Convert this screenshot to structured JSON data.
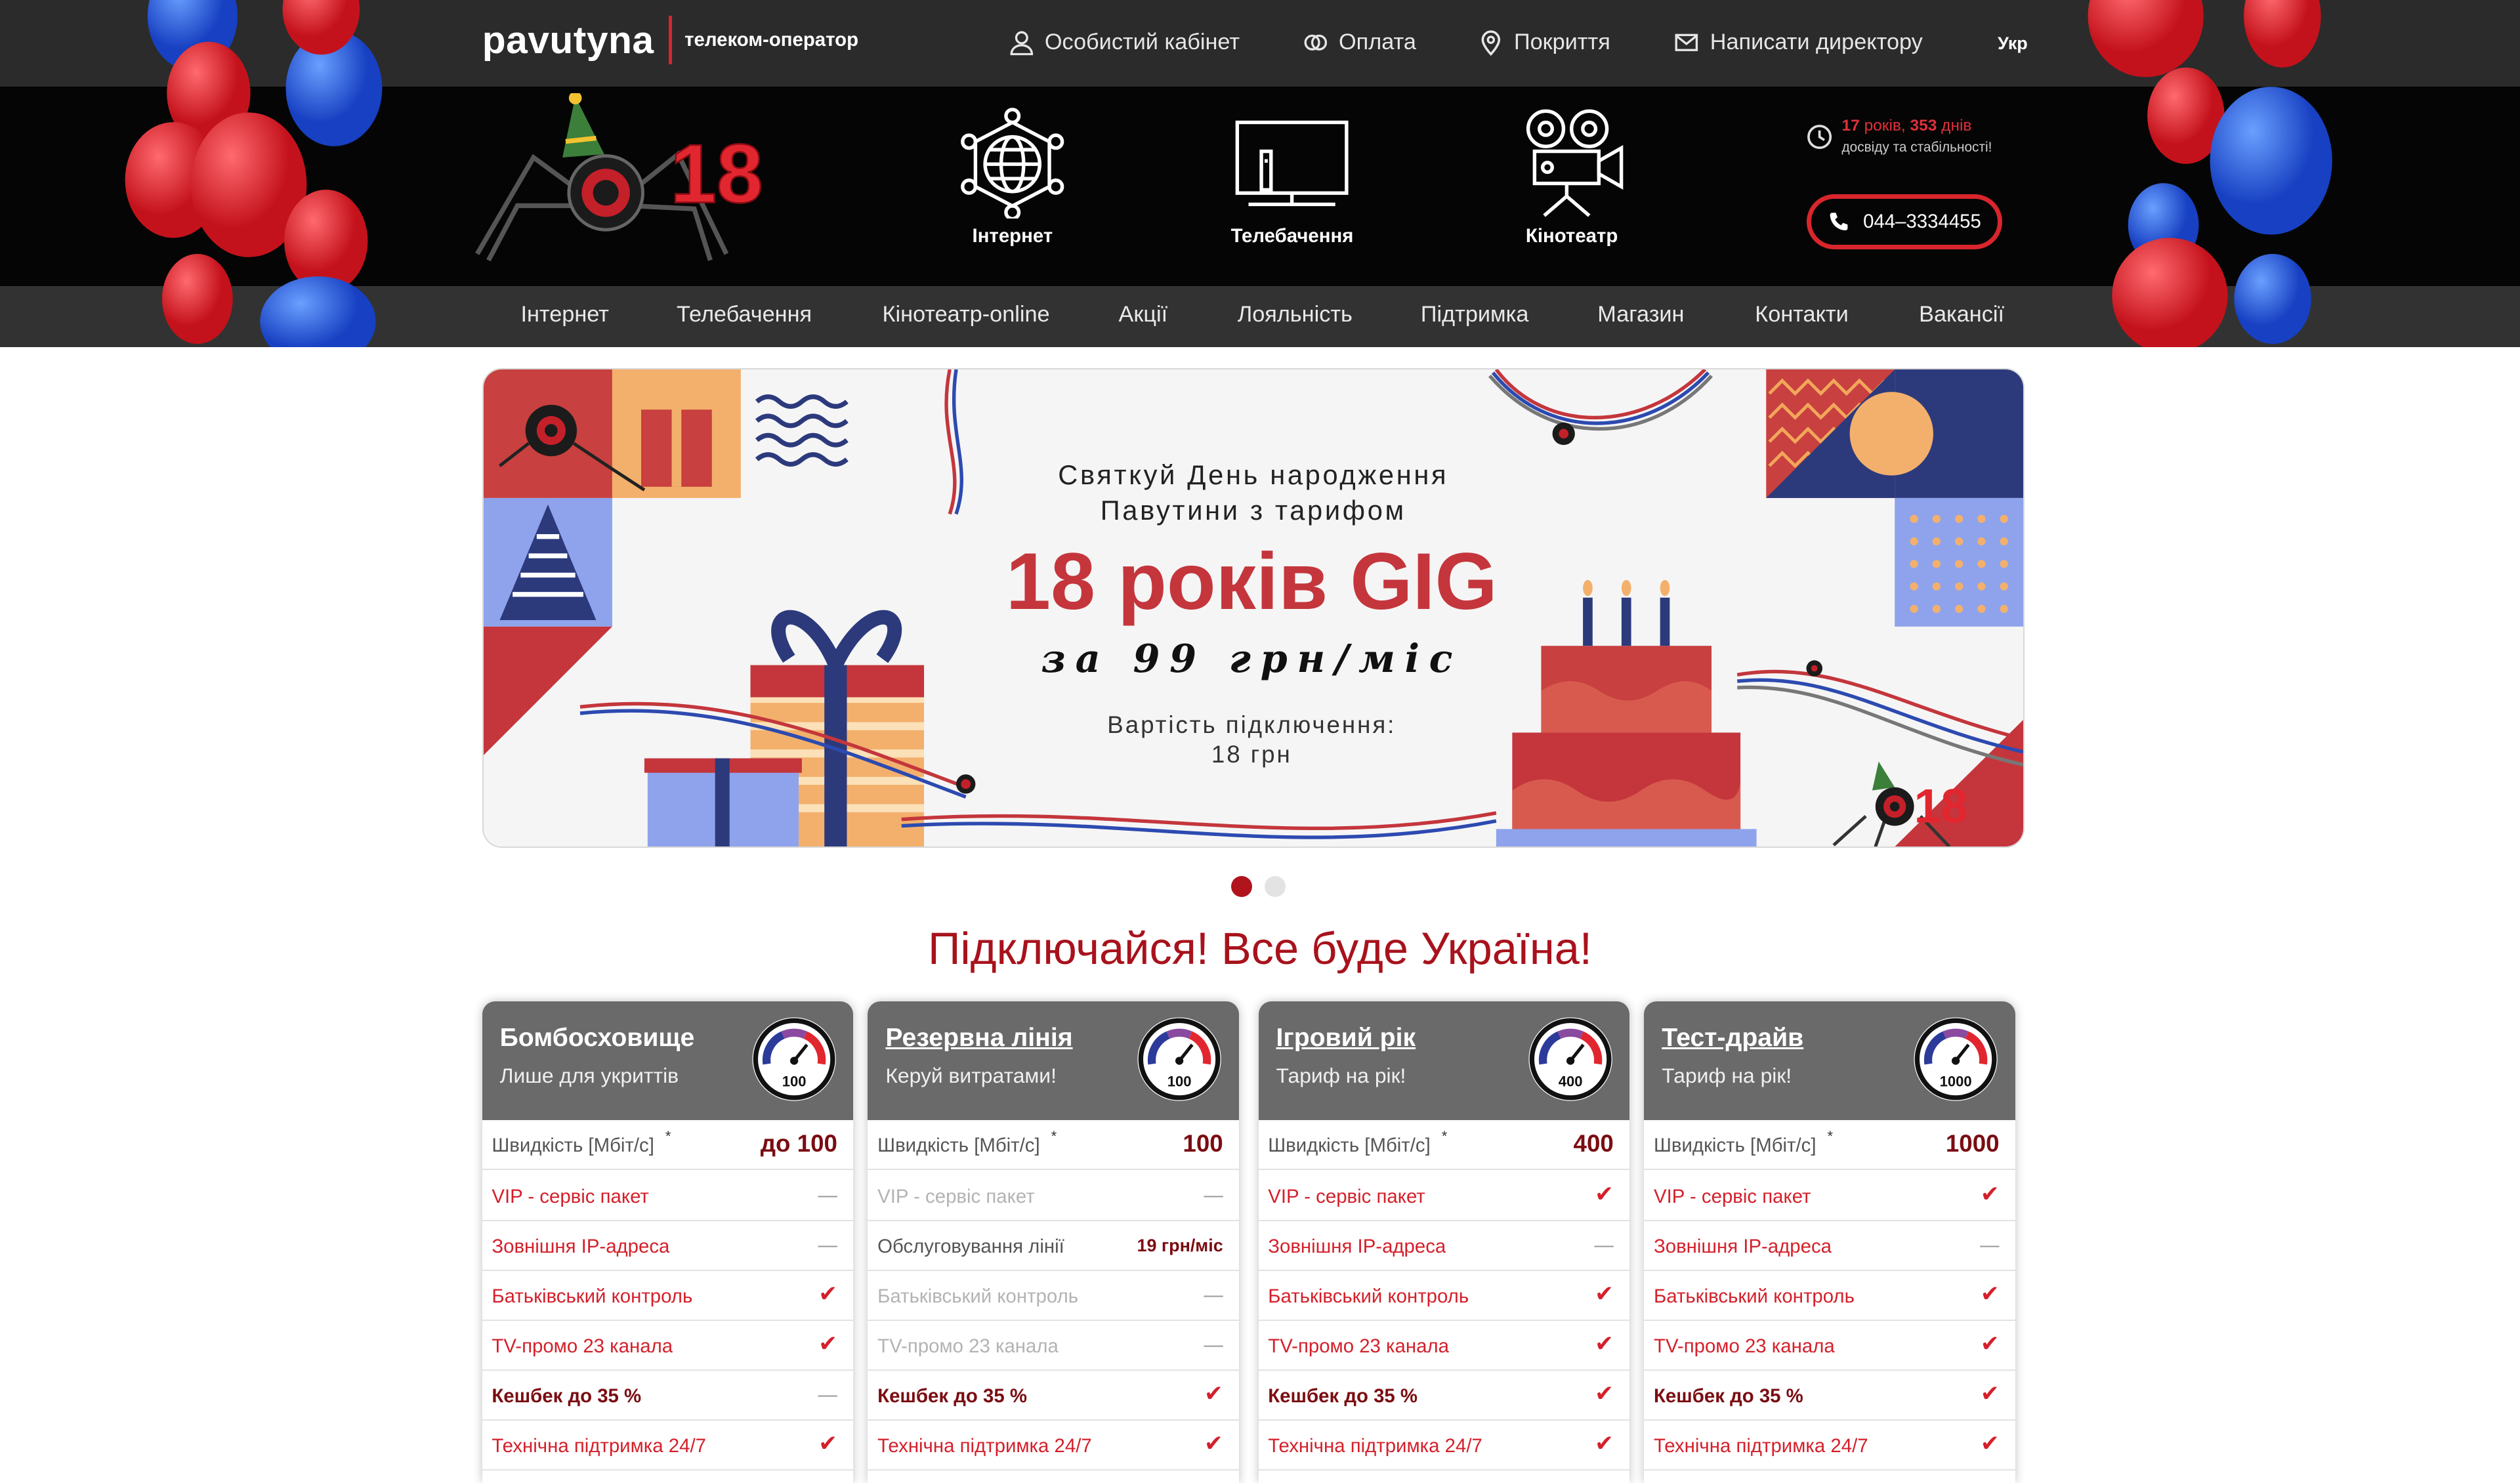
{
  "header": {
    "logo_word": "pavutyna",
    "logo_tagline": "телеком-оператор",
    "links": {
      "cabinet": "Особистий кабінет",
      "payment": "Оплата",
      "coverage": "Покриття",
      "write_director": "Написати директору"
    },
    "language": "Укр"
  },
  "services": {
    "internet": "Інтернет",
    "tv": "Телебачення",
    "cinema": "Кінотеатр"
  },
  "uptime": {
    "years": "17",
    "years_word": "років,",
    "days": "353",
    "days_word": "днів",
    "caption": "досвіду та стабільності!"
  },
  "phone": "044–3334455",
  "nav": [
    "Інтернет",
    "Телебачення",
    "Кінотеатр-online",
    "Акції",
    "Лояльність",
    "Підтримка",
    "Магазин",
    "Контакти",
    "Вакансії"
  ],
  "banner": {
    "line1": "Святкуй День народження",
    "line2": "Павутини з тарифом",
    "title": "18 років GIG",
    "price": "за 99 грн/міс",
    "conn_label": "Вартість підключення:",
    "conn_value": "18 грн",
    "decal_number": "18"
  },
  "slogan": "Підключайся! Все буде Україна!",
  "tariffs": [
    {
      "name": "Бомбосховище",
      "subtitle": "Лише для укриттів",
      "gauge": "100",
      "speed_label": "Швидкість [Мбіт/с]",
      "speed": "до 100",
      "rows": [
        {
          "label": "VIP - сервіс пакет",
          "value": "—"
        },
        {
          "label": "Зовнішня IP-адреса",
          "value": "—"
        },
        {
          "label": "Батьківський контроль",
          "value": "✔"
        },
        {
          "label": "TV-промо 23 канала",
          "value": "✔"
        },
        {
          "label": "Кешбек до 35 %",
          "value": "—"
        },
        {
          "label": "Технічна підтримка 24/7",
          "value": "✔"
        }
      ]
    },
    {
      "name": "Резервна лінія",
      "subtitle": "Керуй витратами!",
      "gauge": "100",
      "speed_label": "Швидкість [Мбіт/с]",
      "speed": "100",
      "rows": [
        {
          "label": "VIP - сервіс пакет",
          "value": "—"
        },
        {
          "label": "Обслуговування лінії",
          "value": "19 грн/міс"
        },
        {
          "label": "Батьківський контроль",
          "value": "—"
        },
        {
          "label": "TV-промо 23 канала",
          "value": "—"
        },
        {
          "label": "Кешбек до 35 %",
          "value": "✔"
        },
        {
          "label": "Технічна підтримка 24/7",
          "value": "✔"
        }
      ]
    },
    {
      "name": "Ігровий рік",
      "subtitle": "Тариф на рік!",
      "gauge": "400",
      "speed_label": "Швидкість [Мбіт/с]",
      "speed": "400",
      "rows": [
        {
          "label": "VIP - сервіс пакет",
          "value": "✔"
        },
        {
          "label": "Зовнішня IP-адреса",
          "value": "—"
        },
        {
          "label": "Батьківський контроль",
          "value": "✔"
        },
        {
          "label": "TV-промо 23 канала",
          "value": "✔"
        },
        {
          "label": "Кешбек до 35 %",
          "value": "✔"
        },
        {
          "label": "Технічна підтримка 24/7",
          "value": "✔"
        }
      ]
    },
    {
      "name": "Тест-драйв",
      "subtitle": "Тариф на рік!",
      "gauge": "1000",
      "speed_label": "Швидкість [Мбіт/с]",
      "speed": "1000",
      "rows": [
        {
          "label": "VIP - сервіс пакет",
          "value": "✔"
        },
        {
          "label": "Зовнішня IP-адреса",
          "value": "—"
        },
        {
          "label": "Батьківський контроль",
          "value": "✔"
        },
        {
          "label": "TV-промо 23 канала",
          "value": "✔"
        },
        {
          "label": "Кешбек до 35 %",
          "value": "✔"
        },
        {
          "label": "Технічна підтримка 24/7",
          "value": "✔"
        }
      ]
    }
  ],
  "colors": {
    "brand_red": "#d9252c",
    "dark_red": "#a8121c",
    "header_bg": "#2b2b2b",
    "strip_bg": "#050505",
    "nav_bg": "#323232",
    "card_head": "#6a6a6a"
  }
}
